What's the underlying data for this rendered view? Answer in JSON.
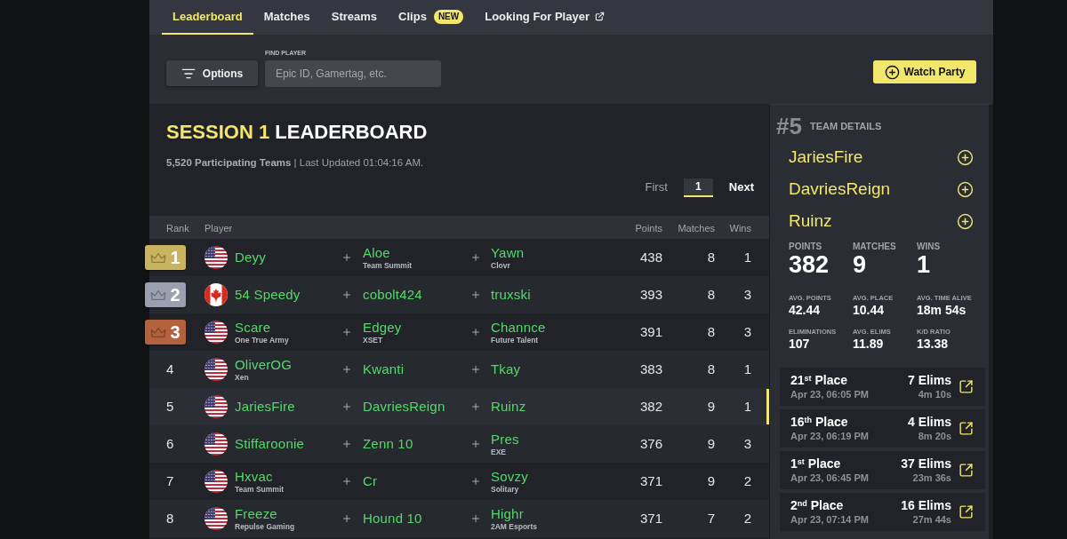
{
  "nav": {
    "tabs": [
      {
        "label": "Leaderboard",
        "selected": true,
        "external": false
      },
      {
        "label": "Matches",
        "selected": false,
        "external": false
      },
      {
        "label": "Streams",
        "selected": false,
        "external": false
      },
      {
        "label": "Clips",
        "selected": false,
        "external": false,
        "badge": "NEW"
      },
      {
        "label": "Looking For Player",
        "selected": false,
        "external": true
      }
    ]
  },
  "toolbar": {
    "options_button": "Options",
    "find_player": {
      "label": "FIND PLAYER",
      "placeholder": "Epic ID, Gamertag, etc."
    },
    "watch_party_button": "Watch Party"
  },
  "leaderboard": {
    "title": {
      "highlight": "SESSION 1",
      "rest": "LEADERBOARD"
    },
    "summary": "**5,520 Participating Teams** | Last Updated 01:04:16 AM.",
    "pagination": {
      "first": "First",
      "pages": [
        {
          "label": "1",
          "selected": true
        }
      ],
      "next": "Next"
    },
    "columns": [
      "Rank",
      "Player",
      "Points",
      "Matches",
      "Wins"
    ],
    "rows": [
      {
        "kind": "medal",
        "color": "#c8b35e",
        "rank": "1",
        "selected": false,
        "players": [
          {
            "kind": "usa",
            "name": "Deyy"
          },
          {
            "kind": "plain",
            "name": "Aloe",
            "team": "Team Summit"
          },
          {
            "kind": "plain",
            "name": "Yawn",
            "team": "Clovr"
          }
        ],
        "points": "438",
        "matches": "8",
        "wins": "1"
      },
      {
        "kind": "medal",
        "color": "#9ba0b1",
        "rank": "2",
        "selected": false,
        "players": [
          {
            "kind": "canada",
            "name": "54 Speedy"
          },
          {
            "kind": "plain",
            "name": "cobolt424"
          },
          {
            "kind": "plain",
            "name": "truxski"
          }
        ],
        "points": "393",
        "matches": "8",
        "wins": "3"
      },
      {
        "kind": "medal",
        "color": "#b4623e",
        "rank": "3",
        "selected": false,
        "players": [
          {
            "kind": "usa",
            "name": "Scare",
            "team": "One True Army"
          },
          {
            "kind": "plain",
            "name": "Edgey",
            "team": "XSET"
          },
          {
            "kind": "plain",
            "name": "Channce",
            "team": "Future Talent"
          }
        ],
        "points": "391",
        "matches": "8",
        "wins": "3"
      },
      {
        "kind": "plain",
        "rank": "4",
        "selected": false,
        "players": [
          {
            "kind": "usa",
            "name": "OliverOG",
            "team": "Xen"
          },
          {
            "kind": "plain",
            "name": "Kwanti"
          },
          {
            "kind": "plain",
            "name": "Tkay"
          }
        ],
        "points": "383",
        "matches": "8",
        "wins": "1"
      },
      {
        "kind": "plain",
        "rank": "5",
        "selected": true,
        "players": [
          {
            "kind": "usa",
            "name": "JariesFire"
          },
          {
            "kind": "plain",
            "name": "DavriesReign"
          },
          {
            "kind": "plain",
            "name": "Ruinz"
          }
        ],
        "points": "382",
        "matches": "9",
        "wins": "1"
      },
      {
        "kind": "plain",
        "rank": "6",
        "selected": false,
        "players": [
          {
            "kind": "usa",
            "name": "Stiffaroonie"
          },
          {
            "kind": "plain",
            "name": "Zenn 10"
          },
          {
            "kind": "plain",
            "name": "Pres",
            "team": "EXE"
          }
        ],
        "points": "376",
        "matches": "9",
        "wins": "3"
      },
      {
        "kind": "plain",
        "rank": "7",
        "selected": false,
        "players": [
          {
            "kind": "usa",
            "name": "Hxvac",
            "team": "Team Summit"
          },
          {
            "kind": "plain",
            "name": "Cr"
          },
          {
            "kind": "plain",
            "name": "Sovzy",
            "team": "Solitary"
          }
        ],
        "points": "371",
        "matches": "9",
        "wins": "2"
      },
      {
        "kind": "plain",
        "rank": "8",
        "selected": false,
        "players": [
          {
            "kind": "usa",
            "name": "Freeze",
            "team": "Repulse Gaming"
          },
          {
            "kind": "plain",
            "name": "Hound 10"
          },
          {
            "kind": "plain",
            "name": "Highr",
            "team": "2AM Esports"
          }
        ],
        "points": "371",
        "matches": "7",
        "wins": "2"
      }
    ]
  },
  "team_details": {
    "rank": "#5",
    "title": "TEAM DETAILS",
    "players": [
      "JariesFire",
      "DavriesReign",
      "Ruinz"
    ],
    "main_stats": [
      {
        "label": "POINTS",
        "value": "382"
      },
      {
        "label": "MATCHES",
        "value": "9"
      },
      {
        "label": "WINS",
        "value": "1"
      }
    ],
    "stats": [
      {
        "label": "AVG. POINTS",
        "value": "42.44"
      },
      {
        "label": "AVG. PLACE",
        "value": "10.44"
      },
      {
        "label": "AVG. TIME ALIVE",
        "value": "18m 54s"
      },
      {
        "label": "ELIMINATIONS",
        "value": "107"
      },
      {
        "label": "AVG. ELIMS",
        "value": "11.89"
      },
      {
        "label": "K/D RATIO",
        "value": "13.38"
      }
    ],
    "matches": [
      {
        "place": "21$^{st}$ Place",
        "time": "Apr 23, 06:05 PM",
        "elims": "7 Elims",
        "duration": "4m 10s"
      },
      {
        "place": "16$^{th}$ Place",
        "time": "Apr 23, 06:19 PM",
        "elims": "4 Elims",
        "duration": "8m 20s"
      },
      {
        "place": "1$^{st}$ Place",
        "time": "Apr 23, 06:45 PM",
        "elims": "37 Elims",
        "duration": "23m 36s"
      },
      {
        "place": "2$^{nd}$ Place",
        "time": "Apr 23, 07:14 PM",
        "elims": "16 Elims",
        "duration": "27m 44s"
      }
    ]
  }
}
